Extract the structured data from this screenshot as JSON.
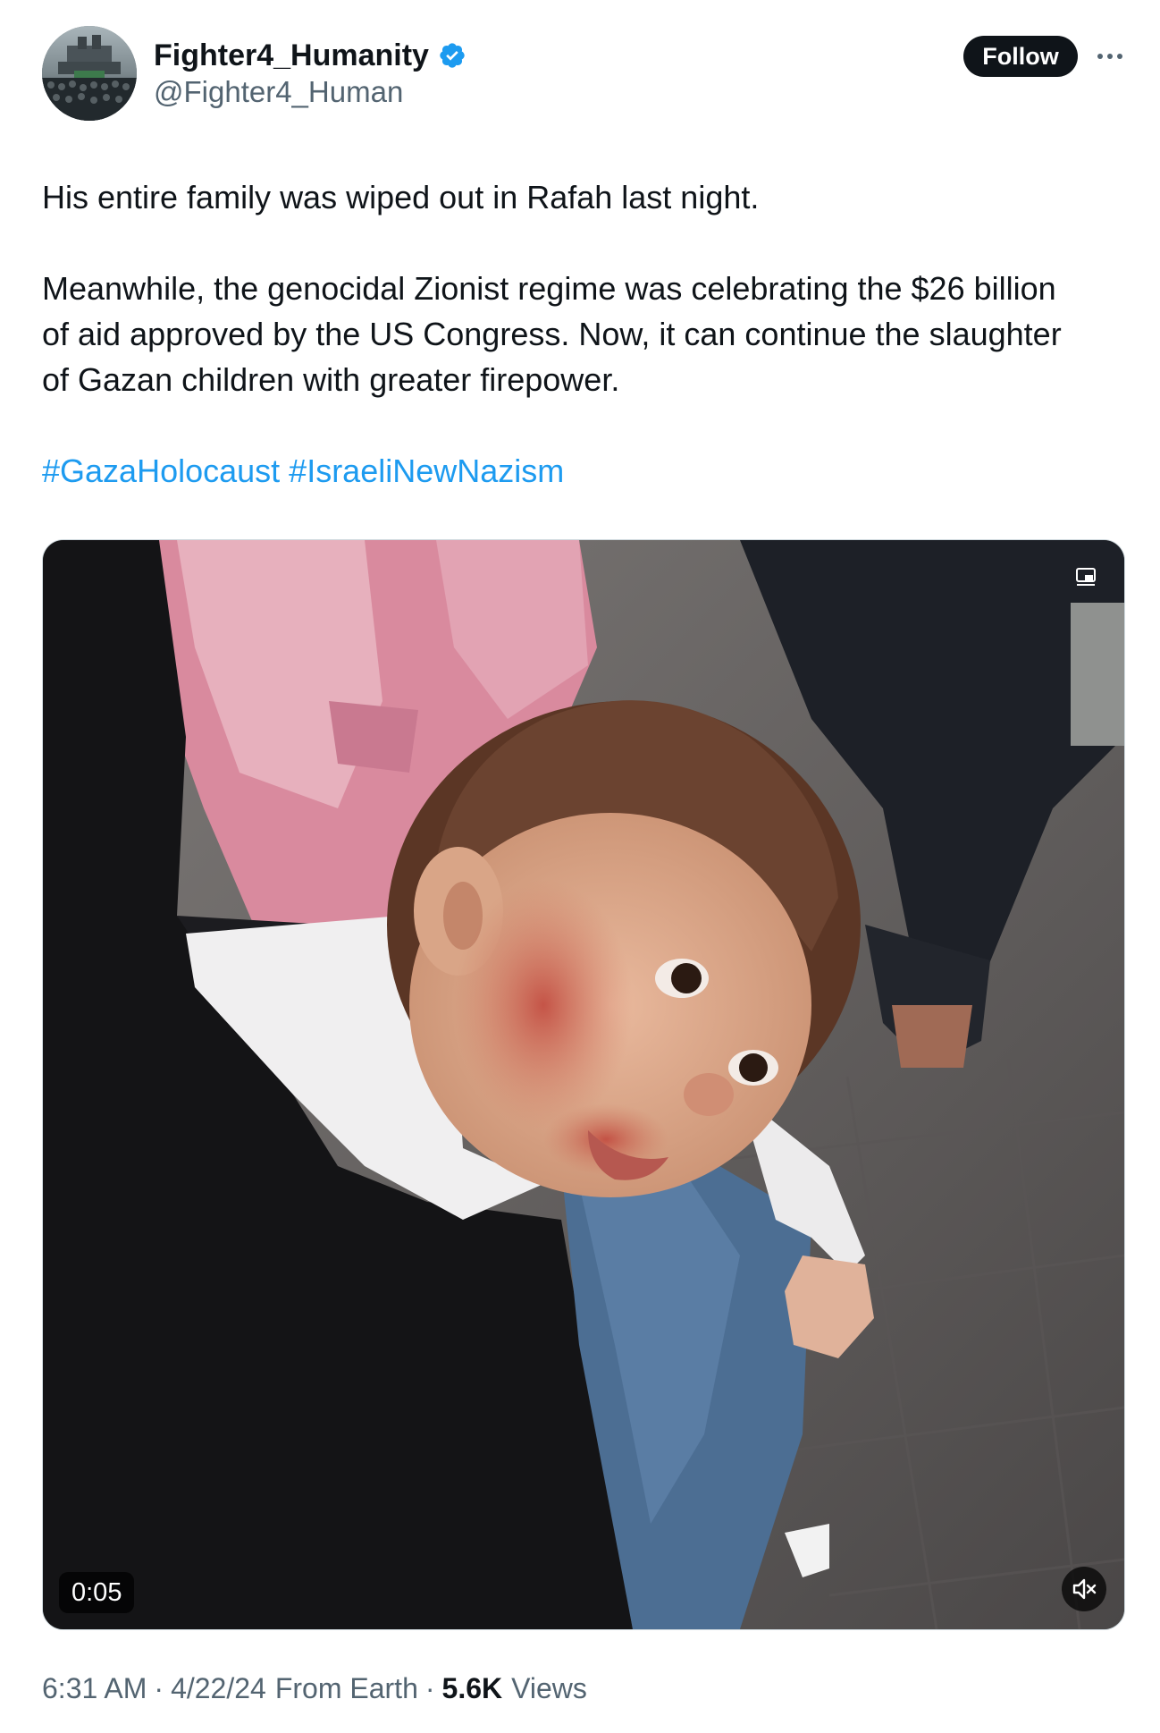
{
  "author": {
    "display_name": "Fighter4_Humanity",
    "handle": "@Fighter4_Human",
    "verified": true,
    "verified_color": "#1d9bf0"
  },
  "actions": {
    "follow_label": "Follow",
    "more_icon": "more-horizontal-icon"
  },
  "tweet": {
    "line1": "His entire family was wiped out in Rafah last night.",
    "line2": "Meanwhile, the genocidal Zionist regime was celebrating the $26 billion",
    "line3": "of aid approved by the US Congress. Now, it can continue the slaughter",
    "line4": "of Gazan children with greater firepower.",
    "hashtag1": "#GazaHolocaust",
    "hashtag2": "#IsraeliNewNazism",
    "hashtag_color": "#1d9bf0"
  },
  "media": {
    "type": "video",
    "duration": "0:05",
    "mute_icon": "speaker-muted-icon",
    "pip_icon": "picture-in-picture-icon"
  },
  "meta": {
    "time": "6:31 AM",
    "date": "4/22/24",
    "source": "From Earth",
    "views_count": "5.6K",
    "views_label": "Views",
    "separator": "·"
  }
}
